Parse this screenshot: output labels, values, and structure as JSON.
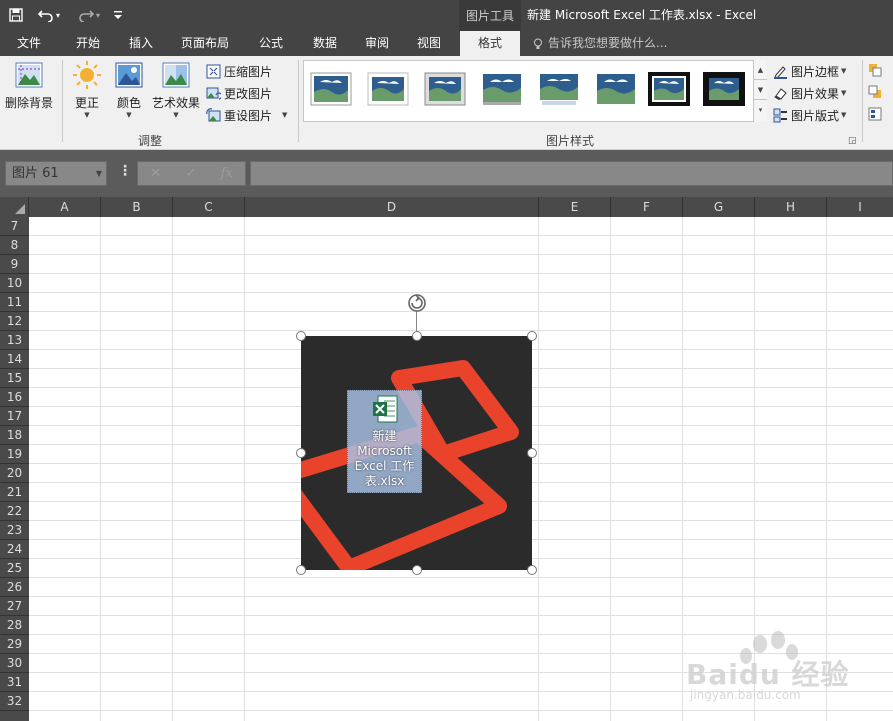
{
  "title_bar": {
    "qat": {
      "save": "💾",
      "undo": "↶",
      "redo": "↷",
      "customize": "⁼"
    },
    "tool_context": "图片工具",
    "window_title": "新建 Microsoft Excel 工作表.xlsx - Excel"
  },
  "tabs": [
    {
      "label": "文件"
    },
    {
      "label": "开始"
    },
    {
      "label": "插入"
    },
    {
      "label": "页面布局"
    },
    {
      "label": "公式"
    },
    {
      "label": "数据"
    },
    {
      "label": "审阅"
    },
    {
      "label": "视图"
    },
    {
      "label": "格式",
      "active": true
    }
  ],
  "tell_me": "告诉我您想要做什么...",
  "ribbon": {
    "remove_bg": "删除背景",
    "corrections": "更正",
    "color": "颜色",
    "artistic": "艺术效果",
    "compress": "压缩图片",
    "change": "更改图片",
    "reset": "重设图片",
    "group_adjust": "调整",
    "group_styles": "图片样式",
    "border": "图片边框",
    "effects": "图片效果",
    "layout": "图片版式"
  },
  "formula_bar": {
    "name_box": "图片 61",
    "cancel": "✕",
    "enter": "✓",
    "fx": "fx"
  },
  "columns": [
    "A",
    "B",
    "C",
    "D",
    "E",
    "F",
    "G",
    "H",
    "I"
  ],
  "rows": [
    "7",
    "8",
    "9",
    "10",
    "11",
    "12",
    "13",
    "14",
    "15",
    "16",
    "17",
    "18",
    "19",
    "20",
    "21",
    "22",
    "23",
    "24",
    "25",
    "26",
    "27",
    "28",
    "29",
    "30",
    "31",
    "32"
  ],
  "file_icon": {
    "label": "新建 Microsoft Excel 工作表.xlsx"
  },
  "watermark": {
    "text": "Baidu 经验",
    "sub": "jingyan.baidu.com"
  },
  "colors": {
    "title_bar": "#444444",
    "ribbon": "#f0f0f0",
    "accent_red": "#e9432c",
    "excel_green": "#1f7346"
  }
}
